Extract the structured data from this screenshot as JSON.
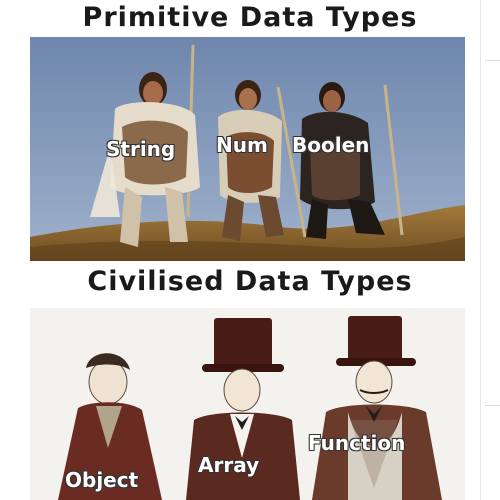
{
  "top": {
    "heading": "Primitive Data Types",
    "labels": {
      "string": "String",
      "num": "Num",
      "boolean": "Boolen"
    }
  },
  "bottom": {
    "heading": "Civilised Data Types",
    "labels": {
      "object": "Object",
      "array": "Array",
      "function": "Function"
    }
  }
}
